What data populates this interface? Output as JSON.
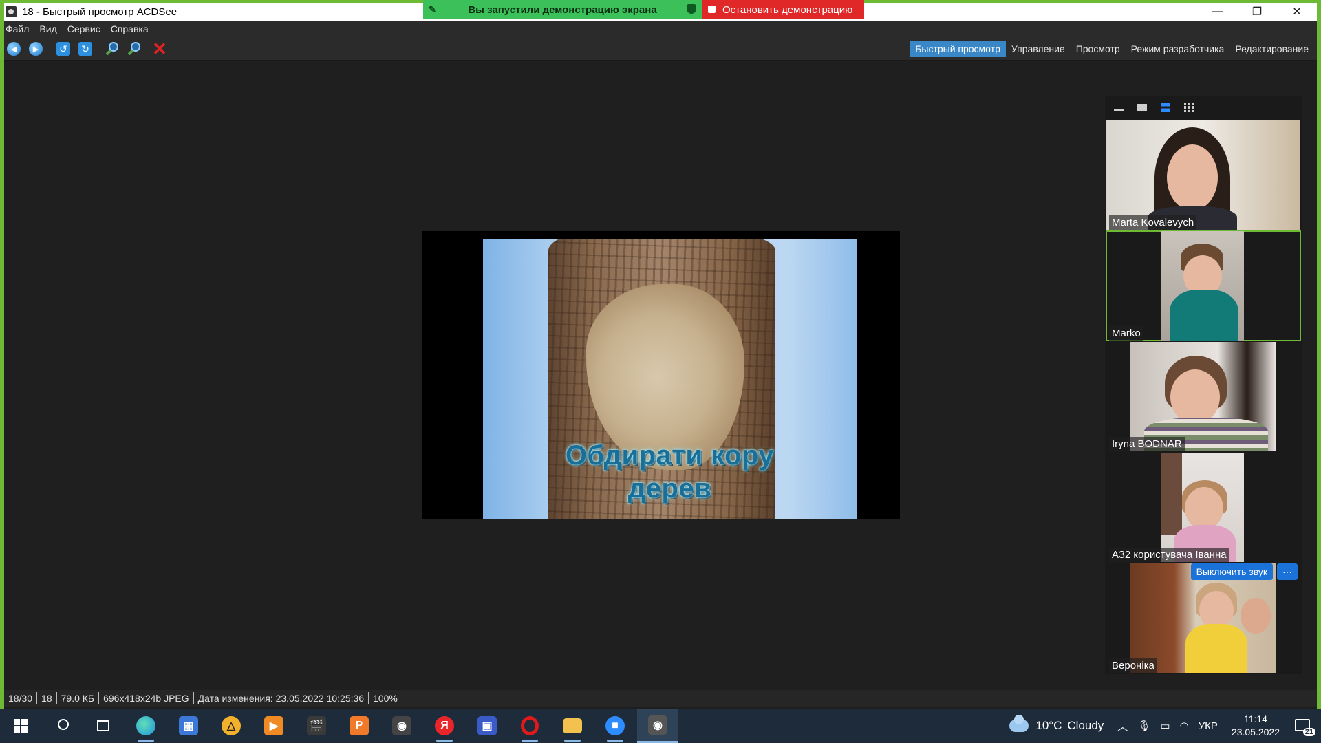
{
  "window": {
    "title": "18 - Быстрый просмотр ACDSee",
    "controls": {
      "minimize": "—",
      "restore": "❐",
      "close": "✕"
    }
  },
  "share_banner": {
    "started_text": "Вы запустили демонстрацию экрана",
    "stop_text": "Остановить демонстрацию"
  },
  "menu": [
    "Файл",
    "Вид",
    "Сервис",
    "Справка"
  ],
  "toolbar": {
    "icons": [
      "back-icon",
      "forward-icon",
      "rotate-left-icon",
      "rotate-right-icon",
      "zoom-in-icon",
      "zoom-out-icon",
      "delete-icon"
    ],
    "modes": [
      {
        "label": "Быстрый просмотр",
        "active": true
      },
      {
        "label": "Управление",
        "active": false
      },
      {
        "label": "Просмотр",
        "active": false
      },
      {
        "label": "Режим разработчика",
        "active": false
      },
      {
        "label": "Редактирование",
        "active": false
      }
    ]
  },
  "image": {
    "caption_line1": "Обдирати кору",
    "caption_line2": "дерев"
  },
  "gallery": {
    "participants": [
      {
        "name": "Marta Kovalevych",
        "speaking": false
      },
      {
        "name": "Marko",
        "speaking": true
      },
      {
        "name": "Iryna BODNAR",
        "speaking": false
      },
      {
        "name": "АЗ2 користувача Іванна",
        "speaking": false
      },
      {
        "name": "Вероніка",
        "speaking": false
      }
    ],
    "mute_label": "Выключить звук",
    "more_label": "···"
  },
  "status": {
    "position": "18/30",
    "name": "18",
    "size": "79.0 КБ",
    "dims": "696x418x24b JPEG",
    "modified": "Дата изменения: 23.05.2022 10:25:36",
    "zoom": "100%"
  },
  "taskbar": {
    "weather_temp": "10°C",
    "weather_desc": "Cloudy",
    "language": "УКР",
    "time": "11:14",
    "date": "23.05.2022",
    "notifications": "21",
    "colors": {
      "edge": "#1f8fe0",
      "store": "#3b78d8",
      "yandex": "#e8262a",
      "opera": "#e01a1a",
      "explorer": "#f2c14e",
      "zoom": "#2d8cff"
    }
  }
}
